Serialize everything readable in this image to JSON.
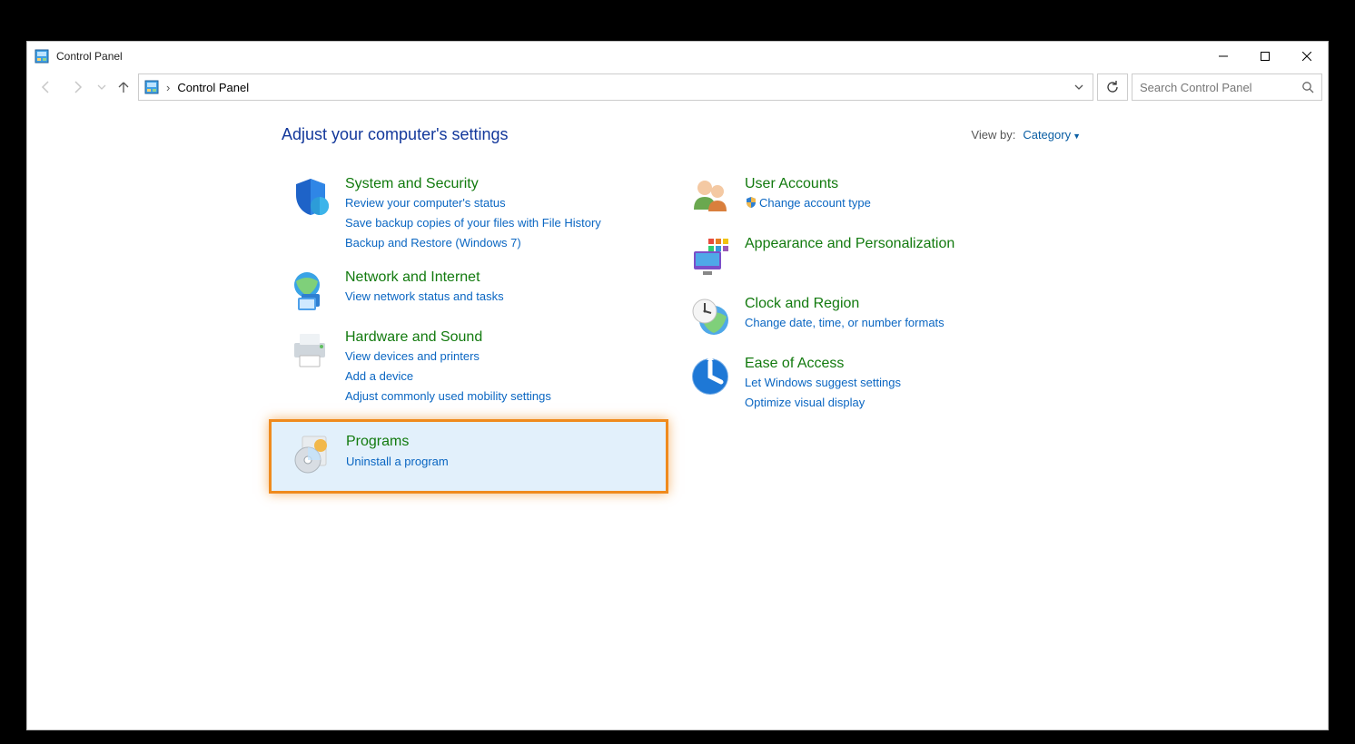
{
  "window": {
    "title": "Control Panel"
  },
  "breadcrumb": {
    "label": "Control Panel"
  },
  "search": {
    "placeholder": "Search Control Panel"
  },
  "heading": "Adjust your computer's settings",
  "viewby": {
    "label": "View by:",
    "value": "Category"
  },
  "left": [
    {
      "title": "System and Security",
      "links": [
        "Review your computer's status",
        "Save backup copies of your files with File History",
        "Backup and Restore (Windows 7)"
      ]
    },
    {
      "title": "Network and Internet",
      "links": [
        "View network status and tasks"
      ]
    },
    {
      "title": "Hardware and Sound",
      "links": [
        "View devices and printers",
        "Add a device",
        "Adjust commonly used mobility settings"
      ]
    },
    {
      "title": "Programs",
      "links": [
        "Uninstall a program"
      ]
    }
  ],
  "right": [
    {
      "title": "User Accounts",
      "links": [
        "Change account type"
      ],
      "shield_links": [
        0
      ]
    },
    {
      "title": "Appearance and Personalization",
      "links": []
    },
    {
      "title": "Clock and Region",
      "links": [
        "Change date, time, or number formats"
      ]
    },
    {
      "title": "Ease of Access",
      "links": [
        "Let Windows suggest settings",
        "Optimize visual display"
      ]
    }
  ]
}
